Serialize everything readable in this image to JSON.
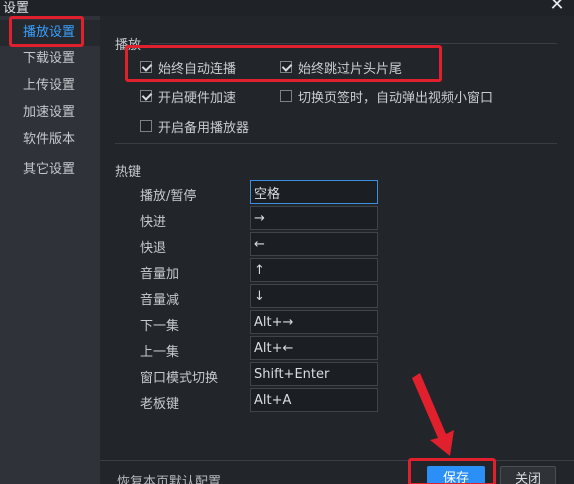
{
  "window": {
    "title": "设置",
    "close_glyph": "✕"
  },
  "sidebar": {
    "items": [
      {
        "label": "播放设置",
        "active": true
      },
      {
        "label": "下载设置"
      },
      {
        "label": "上传设置"
      },
      {
        "label": "加速设置"
      },
      {
        "label": "软件版本"
      },
      {
        "label": "其它设置"
      }
    ]
  },
  "playback": {
    "title": "播放",
    "options": [
      {
        "label": "始终自动连播",
        "checked": true
      },
      {
        "label": "始终跳过片头片尾",
        "checked": true
      },
      {
        "label": "开启硬件加速",
        "checked": true
      },
      {
        "label": "切换页签时，自动弹出视频小窗口",
        "checked": false
      },
      {
        "label": "开启备用播放器",
        "checked": false
      }
    ]
  },
  "hotkeys": {
    "title": "热键",
    "items": [
      {
        "label": "播放/暂停",
        "value": "空格"
      },
      {
        "label": "快进",
        "value": "→"
      },
      {
        "label": "快退",
        "value": "←"
      },
      {
        "label": "音量加",
        "value": "↑"
      },
      {
        "label": "音量减",
        "value": "↓"
      },
      {
        "label": "下一集",
        "value": "Alt+→"
      },
      {
        "label": "上一集",
        "value": "Alt+←"
      },
      {
        "label": "窗口模式切换",
        "value": "Shift+Enter"
      },
      {
        "label": "老板键",
        "value": "Alt+A"
      }
    ]
  },
  "footer": {
    "restore_label": "恢复本页默认配置",
    "save_label": "保存",
    "close_label": "关闭"
  },
  "colors": {
    "accent": "#2a8ff7",
    "highlight": "#e0202c",
    "active_nav": "#3aa0ff"
  }
}
